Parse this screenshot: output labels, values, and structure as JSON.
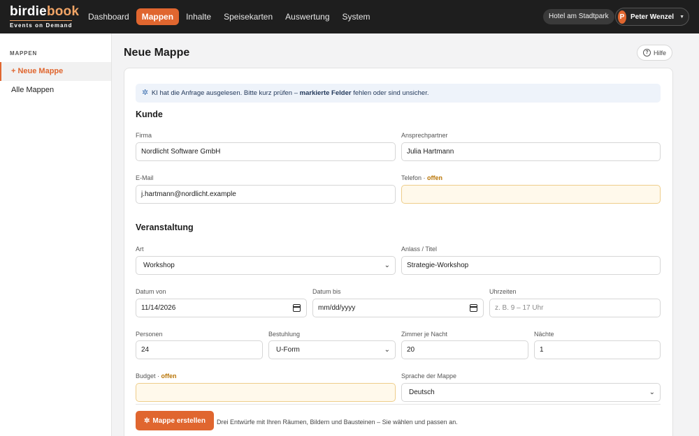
{
  "brand": {
    "part_a": "birdie",
    "part_b": "book",
    "tagline": "Events on Demand",
    "accent": "#e0662f"
  },
  "nav": [
    {
      "label": "Dashboard",
      "active": false
    },
    {
      "label": "Mappen",
      "active": true
    },
    {
      "label": "Inhalte",
      "active": false
    },
    {
      "label": "Speisekarten",
      "active": false
    },
    {
      "label": "Auswertung",
      "active": false
    },
    {
      "label": "System",
      "active": false
    }
  ],
  "header": {
    "hotel": "Hotel am Stadtpark",
    "user_initial": "P",
    "user_name": "Peter Wenzel",
    "caret": "▼"
  },
  "sidebar": {
    "heading": "MAPPEN",
    "items": [
      {
        "label": "+ Neue Mappe",
        "active": true
      },
      {
        "label": "Alle Mappen",
        "active": false
      }
    ]
  },
  "page": {
    "title": "Neue Mappe",
    "help_label": "Hilfe",
    "help_icon": "?"
  },
  "ai_banner": {
    "icon": "sparkle-icon",
    "text_before": "KI hat die Anfrage ausgelesen. Bitte kurz prüfen – ",
    "text_bold": "markierte Felder",
    "text_after": " fehlen oder sind unsicher."
  },
  "open_marker": "offen",
  "sections": {
    "customer": "Kunde",
    "event": "Veranstaltung"
  },
  "customer": {
    "firma_label": "Firma",
    "firma_value": "Nordlicht Software GmbH",
    "contact_label": "Ansprechpartner",
    "contact_value": "Julia Hartmann",
    "email_label": "E-Mail",
    "email_value": "j.hartmann@nordlicht.example",
    "phone_label": "Telefon · ",
    "phone_value": ""
  },
  "event": {
    "art_label": "Art",
    "art_value": "Workshop",
    "occasion_label": "Anlass / Titel",
    "occasion_value": "Strategie-Workshop",
    "date_from_label": "Datum von",
    "date_from_value": "11/14/2026",
    "date_to_label": "Datum bis",
    "date_to_value": "mm/dd/yyyy",
    "times_label": "Uhrzeiten",
    "times_placeholder": "z. B. 9 – 17 Uhr",
    "persons_label": "Personen",
    "persons_value": "24",
    "seating_label": "Bestuhlung",
    "seating_value": "U-Form",
    "rooms_label": "Zimmer je Nacht",
    "rooms_value": "20",
    "nights_label": "Nächte",
    "nights_value": "1",
    "budget_label": "Budget · ",
    "budget_value": "",
    "language_label": "Sprache der Mappe",
    "language_value": "Deutsch"
  },
  "footer": {
    "create_label": "Mappe erstellen",
    "note": "Drei Entwürfe mit Ihren Räumen, Bildern und Bausteinen – Sie wählen und passen an."
  }
}
